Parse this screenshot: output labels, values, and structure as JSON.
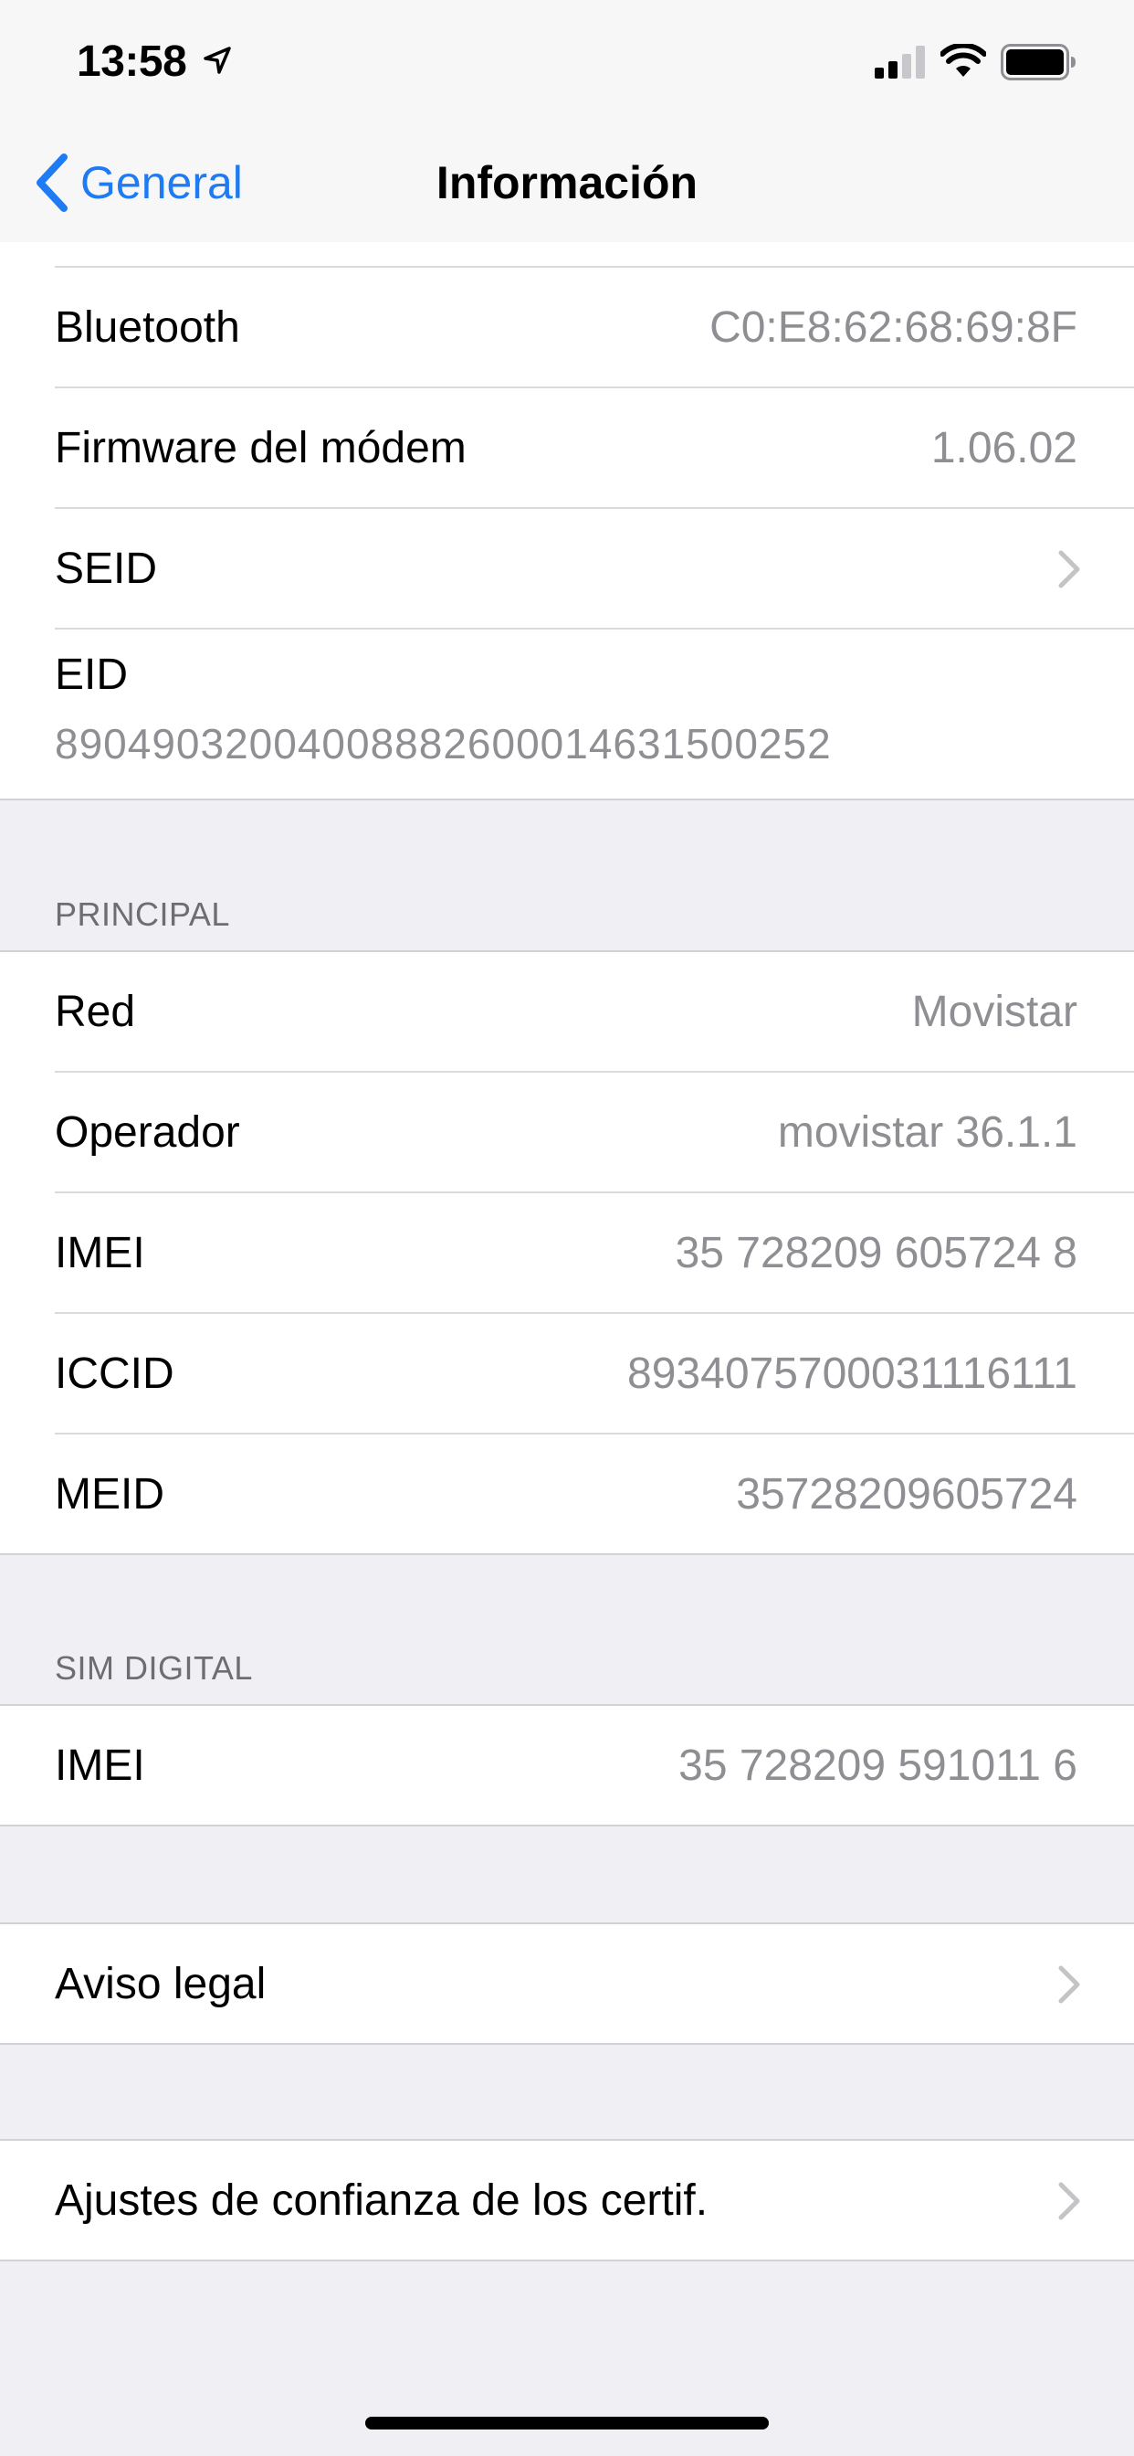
{
  "status_bar": {
    "time": "13:58",
    "icons": [
      "location-arrow-icon",
      "signal-icon",
      "wifi-icon",
      "battery-icon"
    ]
  },
  "nav": {
    "back_label": "General",
    "title": "Información"
  },
  "colors": {
    "accent": "#1f7bf4",
    "background": "#efeff4",
    "secondary_text": "#8e8e93"
  },
  "top_group": {
    "rows": [
      {
        "label": "Bluetooth",
        "value": "C0:E8:62:68:69:8F"
      },
      {
        "label": "Firmware del módem",
        "value": "1.06.02"
      },
      {
        "label": "SEID",
        "value": ""
      },
      {
        "label": "EID",
        "value": "89049032004008882600014631500252"
      }
    ]
  },
  "principal": {
    "header": "PRINCIPAL",
    "rows": [
      {
        "label": "Red",
        "value": "Movistar"
      },
      {
        "label": "Operador",
        "value": "movistar 36.1.1"
      },
      {
        "label": "IMEI",
        "value": "35 728209 605724 8"
      },
      {
        "label": "ICCID",
        "value": "8934075700031116111"
      },
      {
        "label": "MEID",
        "value": "35728209605724"
      }
    ]
  },
  "sim_digital": {
    "header": "SIM DIGITAL",
    "rows": [
      {
        "label": "IMEI",
        "value": "35 728209 591011 6"
      }
    ]
  },
  "links": {
    "legal": "Aviso legal",
    "cert_trust": "Ajustes de confianza de los certif."
  }
}
